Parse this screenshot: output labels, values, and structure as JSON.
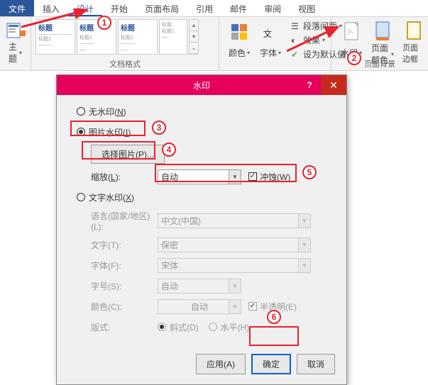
{
  "tabs": {
    "file": "文件",
    "insert": "插入",
    "design": "设计",
    "start": "开始",
    "layout": "页面布局",
    "ref": "引用",
    "mail": "邮件",
    "review": "审阅",
    "view": "视图"
  },
  "ribbon": {
    "theme": "主题",
    "g1": "标题",
    "g2": "标题",
    "g3": "标题",
    "docfmt": "文档格式",
    "color": "颜色",
    "font": "字体",
    "para": "段落间距",
    "effect": "效果",
    "default": "设为默认值",
    "watermark": "水印",
    "pagecolor": "页面颜色",
    "pageborder": "页面边框",
    "pagebg": "页面背景"
  },
  "dialog": {
    "title": "水印",
    "none": "无水印(N)",
    "pic": "图片水印(I)",
    "choose": "选择图片(P)...",
    "scale": "缩放(L):",
    "auto": "自动",
    "washout": "冲蚀(W)",
    "text": "文字水印(X)",
    "lang": "语言(国家/地区)(L):",
    "langval": "中文(中国)",
    "wordlbl": "文字(T):",
    "wordval": "保密",
    "fontlbl": "字体(F):",
    "fontval": "宋体",
    "sizelbl": "字号(S):",
    "sizeval": "自动",
    "colorlbl": "颜色(C):",
    "colorval": "自动",
    "trans": "半透明(E)",
    "layoutlbl": "版式:",
    "diag": "斜式(D)",
    "horiz": "水平(H)",
    "apply": "应用(A)",
    "ok": "确定",
    "cancel": "取消"
  }
}
